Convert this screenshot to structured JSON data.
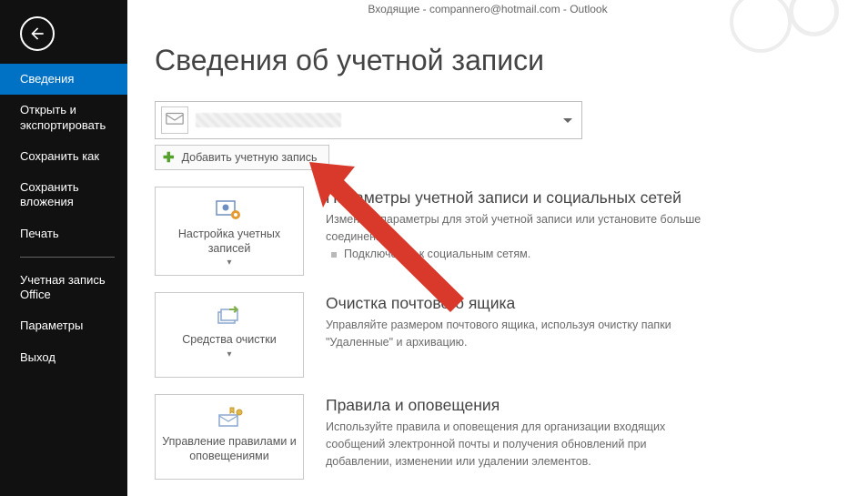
{
  "window": {
    "title": "Входящие - compannero@hotmail.com - Outlook"
  },
  "sidebar": {
    "items": [
      {
        "label": "Сведения"
      },
      {
        "label": "Открыть и экспортировать"
      },
      {
        "label": "Сохранить как"
      },
      {
        "label": "Сохранить вложения"
      },
      {
        "label": "Печать"
      },
      {
        "label": "Учетная запись Office"
      },
      {
        "label": "Параметры"
      },
      {
        "label": "Выход"
      }
    ]
  },
  "page": {
    "heading": "Сведения об учетной записи",
    "add_account": "Добавить учетную запись"
  },
  "tiles": {
    "settings": {
      "label": "Настройка учетных записей",
      "drop": "▾"
    },
    "cleanup": {
      "label": "Средства очистки",
      "drop": "▾"
    },
    "rules": {
      "label": "Управление правилами и оповещениями"
    }
  },
  "sections": {
    "settings": {
      "title": "Параметры учетной записи и социальных сетей",
      "desc": "Измените параметры для этой учетной записи или установите больше соединений.",
      "sub": "Подключение к социальным сетям."
    },
    "cleanup": {
      "title": "Очистка почтового ящика",
      "desc": "Управляйте размером почтового ящика, используя очистку папки \"Удаленные\" и архивацию."
    },
    "rules": {
      "title": "Правила и оповещения",
      "desc": "Используйте правила и оповещения для организации входящих сообщений электронной почты и получения обновлений при добавлении, изменении или удалении элементов."
    }
  }
}
